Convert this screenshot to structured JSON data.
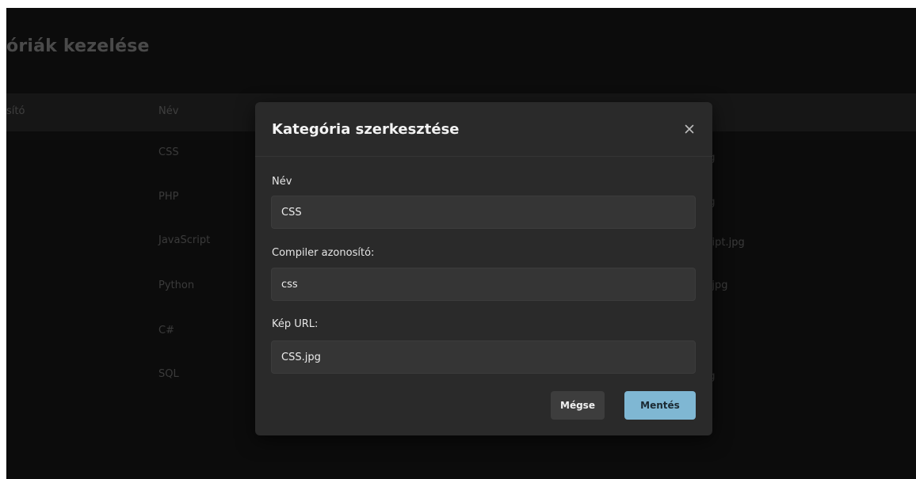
{
  "page": {
    "title": "óriák kezelése"
  },
  "table": {
    "headers": {
      "id": "sító",
      "name": "Név"
    },
    "rows": [
      {
        "name": "CSS",
        "image": "pg"
      },
      {
        "name": "PHP",
        "image": "pg"
      },
      {
        "name": "JavaScript",
        "image": "cript.jpg"
      },
      {
        "name": "Python",
        "image": "n.jpg"
      },
      {
        "name": "C#",
        "image": "g"
      },
      {
        "name": "SQL",
        "image": "pg"
      }
    ]
  },
  "modal": {
    "title": "Kategória szerkesztése",
    "close_icon": "close-icon",
    "fields": {
      "name": {
        "label": "Név",
        "value": "CSS"
      },
      "compiler": {
        "label": "Compiler azonosító:",
        "value": "css"
      },
      "image_url": {
        "label": "Kép URL:",
        "value": "CSS.jpg"
      }
    },
    "buttons": {
      "cancel": "Mégse",
      "save": "Mentés"
    }
  },
  "colors": {
    "background": "#0c0c0c",
    "modal": "#2a2a2a",
    "input": "#353535",
    "primary": "#7fb7d3",
    "secondary": "#3d3d3d"
  }
}
